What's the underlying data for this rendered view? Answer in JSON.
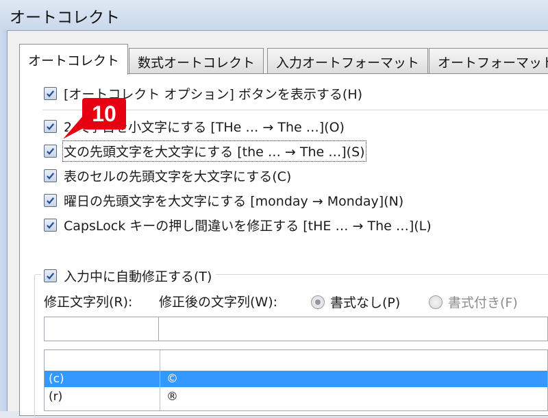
{
  "window": {
    "title": "オートコレクト"
  },
  "tabs": [
    {
      "label": "オートコレクト",
      "active": true
    },
    {
      "label": "数式オートコレクト",
      "active": false
    },
    {
      "label": "入力オートフォーマット",
      "active": false
    },
    {
      "label": "オートフォーマット",
      "active": false
    }
  ],
  "options": {
    "show_button": {
      "label": "[オートコレクト オプション] ボタンを表示する(H)",
      "checked": true
    },
    "two_initial_caps": {
      "label": "2 文字目を小文字にする [THe … → The …](O)",
      "checked": true
    },
    "capitalize_sentence": {
      "label": "文の先頭文字を大文字にする [the … → The …](S)",
      "checked": true
    },
    "capitalize_table_cell": {
      "label": "表のセルの先頭文字を大文字にする(C)",
      "checked": true
    },
    "capitalize_day": {
      "label": "曜日の先頭文字を大文字にする [monday →  Monday](N)",
      "checked": true
    },
    "caps_lock": {
      "label": "CapsLock キーの押し間違いを修正する [tHE … → The …](L)",
      "checked": true
    }
  },
  "replace_group": {
    "legend": "入力中に自動修正する(T)",
    "checked": true,
    "replace_label": "修正文字列(R):",
    "with_label": "修正後の文字列(W):",
    "radio_plain": "書式なし(P)",
    "radio_formatted": "書式付き(F)",
    "replace_value": "",
    "with_value": ""
  },
  "replacements": [
    {
      "from": "(c)",
      "to": "©",
      "selected": true
    },
    {
      "from": "(r)",
      "to": "®",
      "selected": false
    }
  ],
  "annotation": {
    "step": "10"
  },
  "colors": {
    "accent_red": "#e50012",
    "selection_blue": "#3399ff",
    "check_blue": "#1d4f99"
  }
}
